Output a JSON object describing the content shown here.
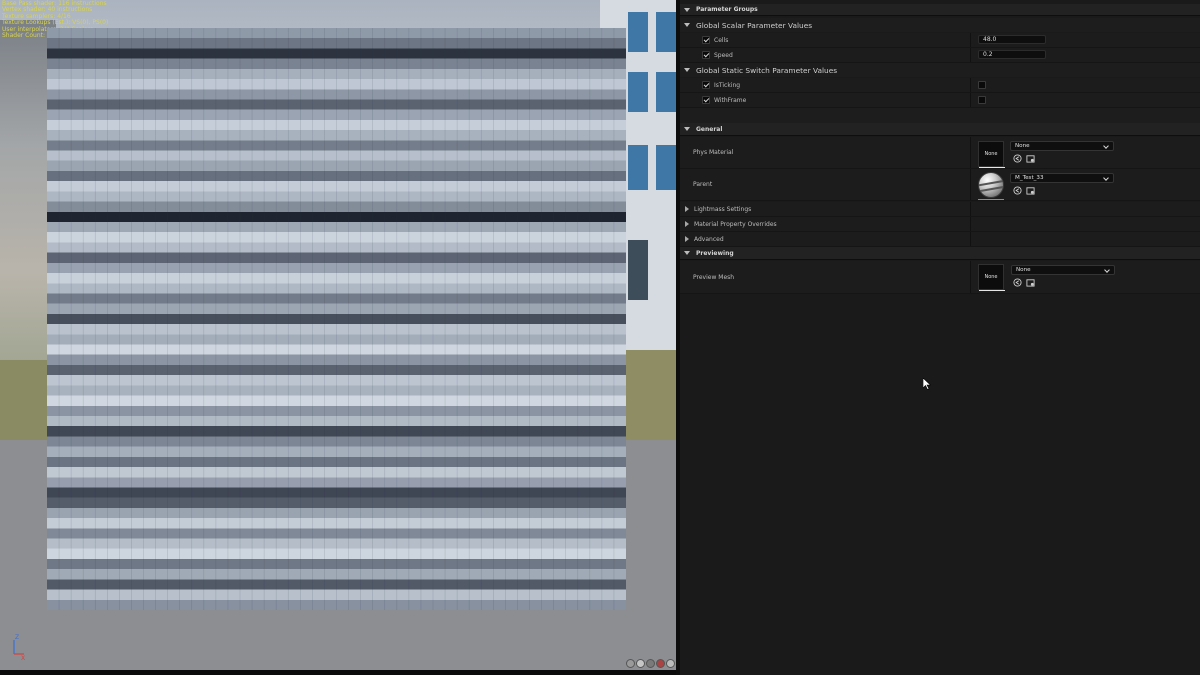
{
  "viewport": {
    "stats_lines": [
      "Base Pass shader: 116 instructions",
      "Vertex shader: 40 instructions",
      "Texture samplers: 4/16",
      "Texture Lookups (Est.): VS(0), PS(0)",
      "User interpolators: 2/4 Scalars",
      "Shader Count: 3"
    ],
    "axis": {
      "x": "X",
      "z": "Z"
    },
    "stripe_shades": [
      "#8f9aa9",
      "#6d7684",
      "#2d3440",
      "#7a8392",
      "#a6b0bd",
      "#bec7d3",
      "#8d97a5",
      "#5b6371",
      "#9aa4b2",
      "#c6ced9",
      "#a8b2bf",
      "#747d8b",
      "#b6bfcb",
      "#9ba5b2",
      "#66707e",
      "#c3ccd7",
      "#adb6c3",
      "#838d9a",
      "#1f2530",
      "#9ea8b5",
      "#cbd3dd",
      "#b2bbc7",
      "#5d6574",
      "#98a2b0",
      "#c8d0da",
      "#aeb7c4",
      "#727b89",
      "#9ca6b3",
      "#484f5c",
      "#b9c2cd",
      "#a3adba",
      "#cfd6df",
      "#8b95a3",
      "#5a6270",
      "#bcc5d0",
      "#a8b2be",
      "#d0d7e0",
      "#8a94a2",
      "#b0bac5",
      "#404755",
      "#7c8694",
      "#a5afbc",
      "#6b7482",
      "#c0c8d2",
      "#979faf",
      "#3f4654",
      "#555d6b",
      "#9aa4b1",
      "#c4ccd6",
      "#7f8997",
      "#b4bdc8",
      "#cdd5de",
      "#6f7886",
      "#a0aab6",
      "#525a68",
      "#b7c0cb",
      "#8791a0"
    ]
  },
  "panel": {
    "parameter_groups": {
      "title": "Parameter Groups",
      "scalar_group": "Global Scalar Parameter Values",
      "scalars": [
        {
          "name": "Cells",
          "value": "48.0",
          "enabled": true
        },
        {
          "name": "Speed",
          "value": "0.2",
          "enabled": true
        }
      ],
      "switch_group": "Global Static Switch Parameter Values",
      "switches": [
        {
          "name": "IsTicking",
          "enabled": true,
          "value": false
        },
        {
          "name": "WithFrame",
          "enabled": true,
          "value": false
        }
      ]
    },
    "general": {
      "title": "General",
      "phys_material": {
        "label": "Phys Material",
        "thumb": "None",
        "value": "None"
      },
      "parent": {
        "label": "Parent",
        "value": "M_Test_33"
      },
      "collapsed": [
        "Lightmass Settings",
        "Material Property Overrides",
        "Advanced"
      ]
    },
    "previewing": {
      "title": "Previewing",
      "preview_mesh": {
        "label": "Preview Mesh",
        "thumb": "None",
        "value": "None"
      }
    }
  },
  "colors": {
    "panel_bg": "#1a1a1a",
    "category_bg": "#222222",
    "stats_text": "#d9d44a",
    "asset_underline_green": "#4bbb4b"
  }
}
